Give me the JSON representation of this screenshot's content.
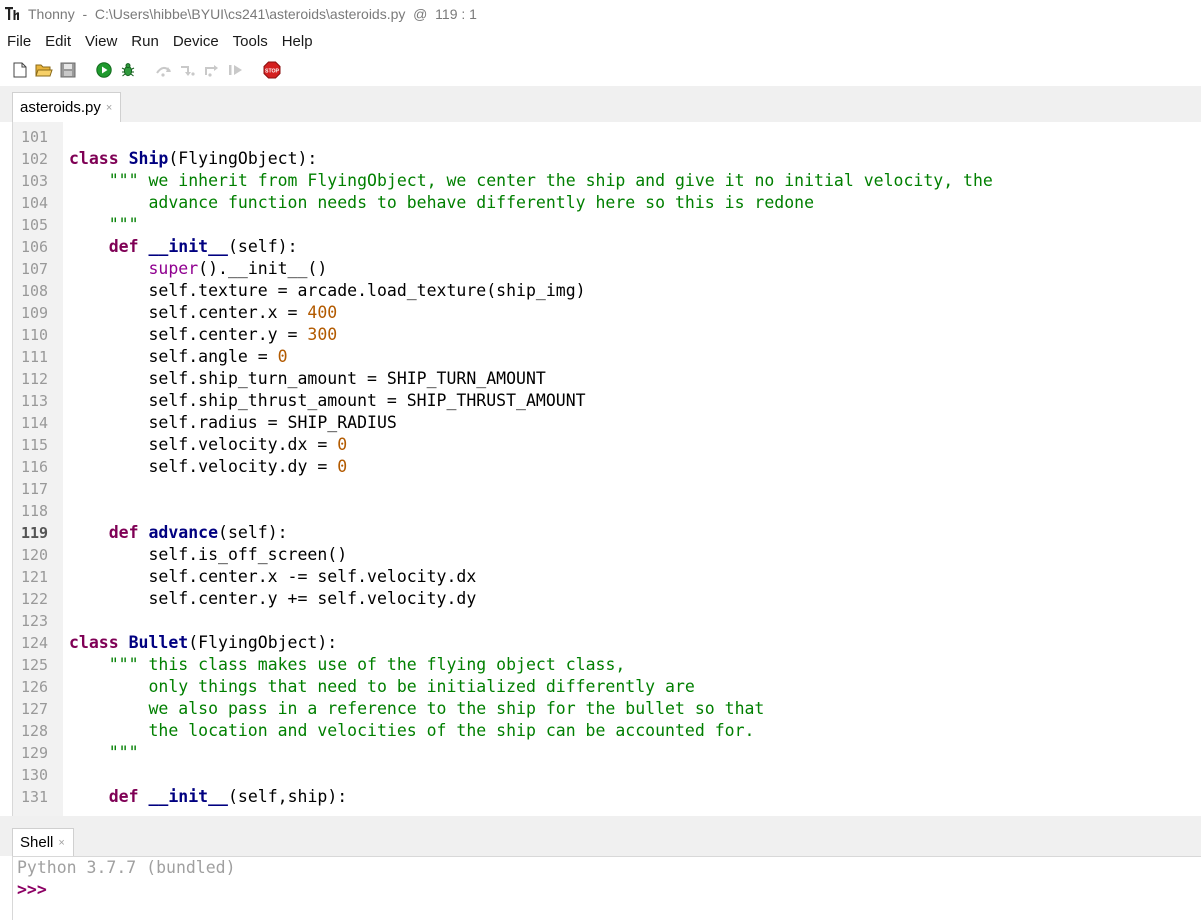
{
  "window": {
    "title": "Thonny  -  C:\\Users\\hibbe\\BYUI\\cs241\\asteroids\\asteroids.py  @  119 : 1",
    "app_icon": "thonny-logo-icon"
  },
  "menu": [
    "File",
    "Edit",
    "View",
    "Run",
    "Device",
    "Tools",
    "Help"
  ],
  "toolbar": {
    "buttons": [
      {
        "name": "new-file-icon",
        "enabled": true
      },
      {
        "name": "open-file-icon",
        "enabled": true
      },
      {
        "name": "save-file-icon",
        "enabled": true
      },
      {
        "name": "run-icon",
        "enabled": true
      },
      {
        "name": "debug-icon",
        "enabled": true
      },
      {
        "name": "step-over-icon",
        "enabled": false
      },
      {
        "name": "step-into-icon",
        "enabled": false
      },
      {
        "name": "step-out-icon",
        "enabled": false
      },
      {
        "name": "resume-icon",
        "enabled": false
      },
      {
        "name": "stop-icon",
        "enabled": true
      }
    ],
    "stop_label": "STOP"
  },
  "editor": {
    "tab_label": "asteroids.py",
    "tab_close": "×",
    "current_line": 119,
    "lines": [
      {
        "n": "101",
        "t": []
      },
      {
        "n": "102",
        "t": [
          [
            "kw",
            "class"
          ],
          [
            "p",
            " "
          ],
          [
            "name",
            "Ship"
          ],
          [
            "p",
            "(FlyingObject):"
          ]
        ]
      },
      {
        "n": "103",
        "t": [
          [
            "p",
            "    "
          ],
          [
            "str",
            "\"\"\" we inherit from FlyingObject, we center the ship and give it no initial velocity, the"
          ]
        ]
      },
      {
        "n": "104",
        "t": [
          [
            "str",
            "        advance function needs to behave differently here so this is redone"
          ]
        ]
      },
      {
        "n": "105",
        "t": [
          [
            "str",
            "    \"\"\""
          ]
        ]
      },
      {
        "n": "106",
        "t": [
          [
            "p",
            "    "
          ],
          [
            "kw",
            "def"
          ],
          [
            "p",
            " "
          ],
          [
            "name",
            "__init__"
          ],
          [
            "p",
            "(self):"
          ]
        ]
      },
      {
        "n": "107",
        "t": [
          [
            "p",
            "        "
          ],
          [
            "builtin",
            "super"
          ],
          [
            "p",
            "().__init__()"
          ]
        ]
      },
      {
        "n": "108",
        "t": [
          [
            "p",
            "        self.texture = arcade.load_texture(ship_img)"
          ]
        ]
      },
      {
        "n": "109",
        "t": [
          [
            "p",
            "        self.center.x = "
          ],
          [
            "num",
            "400"
          ]
        ]
      },
      {
        "n": "110",
        "t": [
          [
            "p",
            "        self.center.y = "
          ],
          [
            "num",
            "300"
          ]
        ]
      },
      {
        "n": "111",
        "t": [
          [
            "p",
            "        self.angle = "
          ],
          [
            "num",
            "0"
          ]
        ]
      },
      {
        "n": "112",
        "t": [
          [
            "p",
            "        self.ship_turn_amount = SHIP_TURN_AMOUNT"
          ]
        ]
      },
      {
        "n": "113",
        "t": [
          [
            "p",
            "        self.ship_thrust_amount = SHIP_THRUST_AMOUNT"
          ]
        ]
      },
      {
        "n": "114",
        "t": [
          [
            "p",
            "        self.radius = SHIP_RADIUS"
          ]
        ]
      },
      {
        "n": "115",
        "t": [
          [
            "p",
            "        self.velocity.dx = "
          ],
          [
            "num",
            "0"
          ]
        ]
      },
      {
        "n": "116",
        "t": [
          [
            "p",
            "        self.velocity.dy = "
          ],
          [
            "num",
            "0"
          ]
        ]
      },
      {
        "n": "117",
        "t": []
      },
      {
        "n": "118",
        "t": []
      },
      {
        "n": "119",
        "t": [
          [
            "p",
            "    "
          ],
          [
            "kw",
            "def"
          ],
          [
            "p",
            " "
          ],
          [
            "name",
            "advance"
          ],
          [
            "p",
            "(self):"
          ]
        ]
      },
      {
        "n": "120",
        "t": [
          [
            "p",
            "        self.is_off_screen()"
          ]
        ]
      },
      {
        "n": "121",
        "t": [
          [
            "p",
            "        self.center.x -= self.velocity.dx"
          ]
        ]
      },
      {
        "n": "122",
        "t": [
          [
            "p",
            "        self.center.y += self.velocity.dy"
          ]
        ]
      },
      {
        "n": "123",
        "t": []
      },
      {
        "n": "124",
        "t": [
          [
            "kw",
            "class"
          ],
          [
            "p",
            " "
          ],
          [
            "name",
            "Bullet"
          ],
          [
            "p",
            "(FlyingObject):"
          ]
        ]
      },
      {
        "n": "125",
        "t": [
          [
            "p",
            "    "
          ],
          [
            "str",
            "\"\"\" this class makes use of the flying object class,"
          ]
        ]
      },
      {
        "n": "126",
        "t": [
          [
            "str",
            "        only things that need to be initialized differently are"
          ]
        ]
      },
      {
        "n": "127",
        "t": [
          [
            "str",
            "        we also pass in a reference to the ship for the bullet so that"
          ]
        ]
      },
      {
        "n": "128",
        "t": [
          [
            "str",
            "        the location and velocities of the ship can be accounted for."
          ]
        ]
      },
      {
        "n": "129",
        "t": [
          [
            "str",
            "    \"\"\""
          ]
        ]
      },
      {
        "n": "130",
        "t": []
      },
      {
        "n": "131",
        "t": [
          [
            "p",
            "    "
          ],
          [
            "kw",
            "def"
          ],
          [
            "p",
            " "
          ],
          [
            "name",
            "__init__"
          ],
          [
            "p",
            "(self,ship):"
          ]
        ]
      }
    ]
  },
  "shell": {
    "tab_label": "Shell",
    "tab_close": "×",
    "banner": "Python 3.7.7 (bundled)",
    "prompt": ">>>"
  },
  "colors": {
    "keyword": "#7f0055",
    "def_name": "#000080",
    "string": "#007f00",
    "number": "#b25a00",
    "builtin": "#900090",
    "gutter_bg": "#f2f2f2"
  }
}
